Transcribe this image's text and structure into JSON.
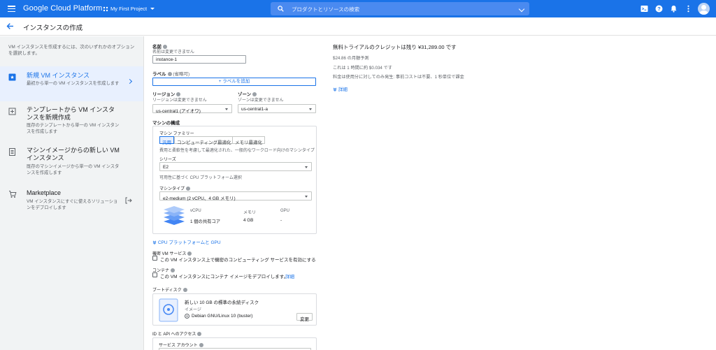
{
  "topbar": {
    "brand": "Google Cloud Platform",
    "project": "My First Project",
    "search_placeholder": "プロダクトとリソースの検索",
    "icons": [
      "menu-icon",
      "project-icon",
      "search-icon",
      "chevron-down-icon",
      "cloud-shell-icon",
      "help-icon",
      "notifications-icon",
      "more-vert-icon",
      "account-avatar"
    ]
  },
  "header": {
    "title": "インスタンスの作成"
  },
  "left": {
    "intro": "VM インスタンスを作成するには、次のいずれかのオプションを選択します。",
    "options": [
      {
        "title": "新規 VM インスタンス",
        "desc": "最初から単一の VM インスタンスを作成します"
      },
      {
        "title": "テンプレートから VM インスタンスを新規作成",
        "desc": "既存のテンプレートから単一の VM インスタンスを作成します"
      },
      {
        "title": "マシンイメージからの新しい VM インスタンス",
        "desc": "既存のマシンイメージから単一の VM インスタンスを作成します"
      },
      {
        "title": "Marketplace",
        "desc": "VM インスタンスにすぐに使えるソリューションをデプロイします"
      }
    ]
  },
  "form": {
    "name_label": "名前",
    "name_sub": "名前は変更できません",
    "name_value": "instance-1",
    "labels_label": "ラベル",
    "labels_optional": "(省略可)",
    "add_label_button": "+ ラベルを追加",
    "region_label": "リージョン",
    "region_sub": "リージョンは変更できません",
    "region_value": "us-central1 (アイオワ)",
    "zone_label": "ゾーン",
    "zone_sub": "ゾーンは変更できません",
    "zone_value": "us-central1-a",
    "machine_config_label": "マシンの構成",
    "machine_family_label": "マシン ファミリー",
    "family_tabs": [
      "汎用",
      "コンピューティング最適化",
      "メモリ最適化"
    ],
    "family_desc": "費用と柔軟性を考慮して最適化された、一般的なワークロード向けのマシンタイプ",
    "series_label": "シリーズ",
    "series_value": "E2",
    "series_desc": "可用性に基づく CPU プラットフォーム選択",
    "machine_type_label": "マシンタイプ",
    "machine_type_value": "e2-medium (2 vCPU、4 GB メモリ)",
    "spec_headers": [
      "vCPU",
      "メモリ",
      "GPU"
    ],
    "spec_values": [
      "1 個の共有コア",
      "4 GB",
      "-"
    ],
    "cpu_platform_link": "CPU プラットフォームと GPU",
    "confidential_label": "機密 VM サービス",
    "confidential_text": "この VM インスタンス上で機密のコンピューティング サービスを有効にする",
    "container_label": "コンテナ",
    "container_text": "この VM インスタンスにコンテナ イメージをデプロイします。",
    "container_link": "詳細",
    "boot_disk_label": "ブートディスク",
    "boot_disk_title": "新しい 10 GB の標準の永続ディスク",
    "boot_disk_image_label": "イメージ",
    "boot_disk_os": "Debian GNU/Linux 10 (buster)",
    "boot_disk_change": "変更",
    "identity_label": "ID と API へのアクセス",
    "service_account_label": "サービス アカウント"
  },
  "info": {
    "title": "無料トライアルのクレジットは残り ¥31,289.00 です",
    "monthly": "$24.86 の月額予測",
    "hourly": "これは 1 時間に約 $0.034 です",
    "billing": "料金は使用分に対してのみ発生: 事前コストは不要、1 秒単位で課金",
    "details_link": "詳細"
  },
  "colors": {
    "primary": "#1a73e8",
    "panel": "#f1f3f4"
  }
}
